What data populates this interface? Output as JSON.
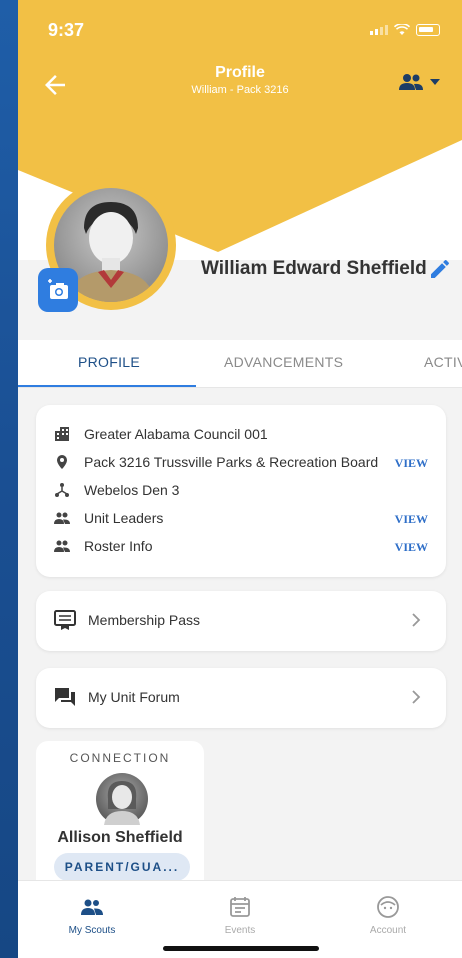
{
  "status_bar": {
    "time": "9:37"
  },
  "header": {
    "title": "Profile",
    "subtitle": "William - Pack 3216",
    "accent_color": "#f2c045"
  },
  "profile": {
    "name": "William Edward Sheffield"
  },
  "tabs": [
    {
      "label": "PROFILE",
      "active": true
    },
    {
      "label": "ADVANCEMENTS",
      "active": false
    },
    {
      "label": "ACTIV",
      "active": false
    }
  ],
  "info": {
    "rows": [
      {
        "icon": "building-icon",
        "text": "Greater Alabama Council 001",
        "action": ""
      },
      {
        "icon": "location-pin-icon",
        "text": "Pack 3216 Trussville Parks & Recreation Board",
        "action": "VIEW"
      },
      {
        "icon": "den-icon",
        "text": "Webelos Den 3",
        "action": ""
      },
      {
        "icon": "people-icon",
        "text": "Unit Leaders",
        "action": "VIEW"
      },
      {
        "icon": "people-icon",
        "text": "Roster Info",
        "action": "VIEW"
      }
    ]
  },
  "links": {
    "membership": "Membership Pass",
    "forum": "My Unit Forum"
  },
  "connection": {
    "label": "CONNECTION",
    "name": "Allison Sheffield",
    "role": "PARENT/GUA..."
  },
  "bottom_nav": [
    {
      "label": "My Scouts",
      "icon": "scouts-icon",
      "active": true
    },
    {
      "label": "Events",
      "icon": "calendar-icon",
      "active": false
    },
    {
      "label": "Account",
      "icon": "account-icon",
      "active": false
    }
  ],
  "colors": {
    "primary": "#1d4f87",
    "link": "#2f6fc8",
    "camera": "#2f7de0"
  }
}
